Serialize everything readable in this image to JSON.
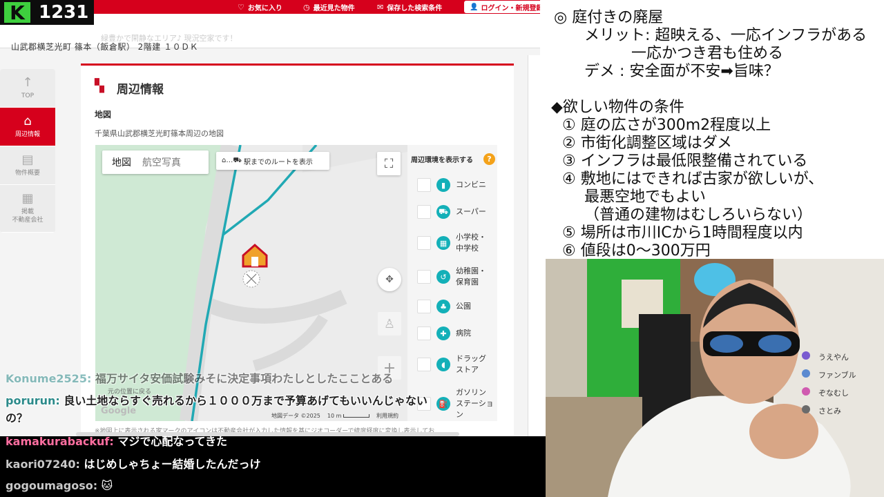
{
  "stream": {
    "counter": "1231",
    "logo_letter": "K"
  },
  "site": {
    "nav": [
      {
        "icon": "♡",
        "label": "お気に入り"
      },
      {
        "icon": "◷",
        "label": "最近見た物件"
      },
      {
        "icon": "✉",
        "label": "保存した検索条件"
      }
    ],
    "login_label": "ログイン・新規登録",
    "faded_banner": "緑豊かで閑静なエリア♪ 現況空家です！",
    "property_title": "山武郡横芝光町 篠本（飯倉駅） 2階建 １０ＤＫ"
  },
  "sidenav": [
    {
      "icon": "↑",
      "label": "TOP",
      "active": false
    },
    {
      "icon": "⌂",
      "label": "周辺情報",
      "active": true
    },
    {
      "icon": "▤",
      "label": "物件概要",
      "active": false
    },
    {
      "icon": "▦",
      "label": "掲載\n不動産会社",
      "active": false
    }
  ],
  "section": {
    "title": "周辺情報",
    "map_heading": "地図",
    "map_subtitle": "千葉県山武郡横芝光町篠本周辺の地図",
    "note": "※地図上に表示される家マークのアイコンは不動産会社が入力した情報を基にジオコーダーで緯度経度に変換し表示してお"
  },
  "map": {
    "tab_map": "地図",
    "tab_aerial": "航空写真",
    "route_label": "駅までのルートを表示",
    "reset_label": "元の位置に戻る",
    "google": "Google",
    "credit": "地図データ ©2025",
    "scale": "10 m",
    "terms": "利用規約"
  },
  "env": {
    "title": "周辺環境を表示する",
    "items": [
      {
        "icon": "▮",
        "label": "コンビニ"
      },
      {
        "icon": "⛟",
        "label": "スーパー"
      },
      {
        "icon": "▦",
        "label": "小学校・\n中学校"
      },
      {
        "icon": "↺",
        "label": "幼稚園・\n保育園"
      },
      {
        "icon": "♣",
        "label": "公園"
      },
      {
        "icon": "✚",
        "label": "病院"
      },
      {
        "icon": "◖",
        "label": "ドラッグ\nストア"
      },
      {
        "icon": "⛽",
        "label": "ガソリン\nステーション"
      }
    ]
  },
  "chat": [
    {
      "user": "Konume2525:",
      "msg": " 福万サイタ安価試験みそに決定事項わたしとしたこことある",
      "style": "light"
    },
    {
      "user": "porurun:",
      "msg": " 良い土地ならすぐ売れるから１０００万まで予算あげてもいいんじゃない",
      "style": "light"
    },
    {
      "user": "",
      "msg": "の？",
      "style": "light"
    },
    {
      "user": "kamakurabackuf:",
      "msg": " マジで心配なってきた",
      "style": "dark-pink"
    },
    {
      "user": "kaori07240:",
      "msg": " はじめしゃちょー結婚したんだっけ",
      "style": "dark"
    },
    {
      "user": "gogoumagoso:",
      "msg": " 🐱",
      "style": "dark"
    }
  ],
  "notes": [
    "◎ 庭付きの廃屋",
    "メリット: 超映える、一応インフラがある",
    "一応かつき君も住める",
    "デメ : 安全面が不安➡旨味？",
    "◆欲しい物件の条件",
    "① 庭の広さが300m2程度以上",
    "② 市街化調整区域はダメ",
    "③ インフラは最低限整備されている",
    "④ 敷地にはできれば古家が欲しいが、",
    "最悪空地でもよい",
    "（普通の建物はむしろいらない）",
    "⑤ 場所は市川ICから1時間程度以内",
    "⑥ 値段は0～300万円"
  ],
  "cam_labels": [
    "うえやん",
    "ファンブル",
    "ぞなむし",
    "さとみ"
  ],
  "colors": {
    "brand_red": "#d6001c",
    "map_route": "#21a9b4",
    "env_icon": "#13b0b8",
    "help": "#f4a21a",
    "logo_green": "#3ecf3e"
  }
}
